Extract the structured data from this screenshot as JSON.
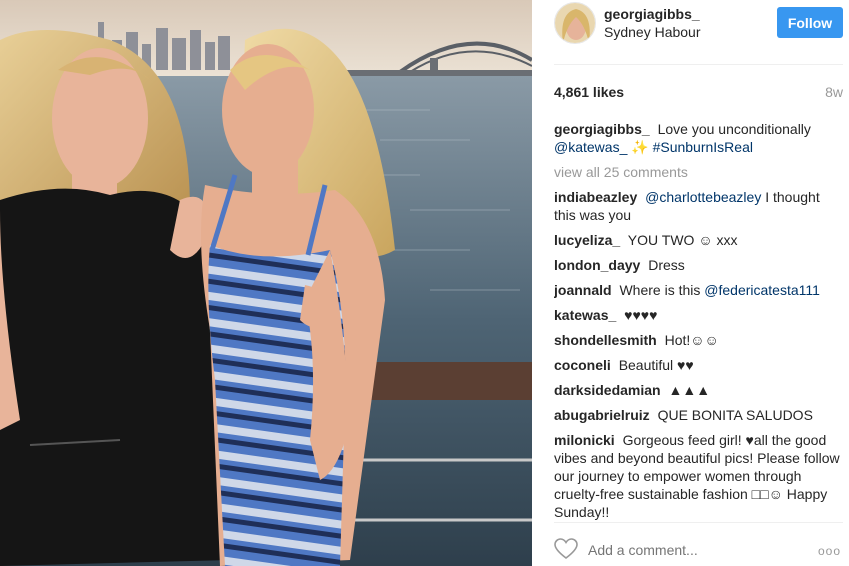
{
  "post": {
    "username": "georgiagibbs_",
    "location": "Sydney Habour",
    "follow_label": "Follow",
    "likes": "4,861 likes",
    "age": "8w",
    "add_comment_placeholder": "Add a comment...",
    "more_label": "ooo",
    "accent_color": "#3897f0"
  },
  "caption": {
    "user": "georgiagibbs_",
    "text_1": "Love you unconditionally",
    "mention": "@katewas_",
    "sparkle": "✨",
    "hashtag": "#SunburnIsReal"
  },
  "view_all": "view all 25 comments",
  "comments": [
    {
      "user": "indiabeazley",
      "link": "@charlottebeazley",
      "text": "I thought this was you"
    },
    {
      "user": "lucyeliza_",
      "text": "YOU TWO ☺ xxx"
    },
    {
      "user": "london_dayy",
      "text": "Dress"
    },
    {
      "user": "joannald",
      "text": "Where is this",
      "link": "@federicatesta111"
    },
    {
      "user": "katewas_",
      "text": "♥♥♥♥"
    },
    {
      "user": "shondellesmith",
      "text": "Hot!☺☺"
    },
    {
      "user": "coconeli",
      "text": "Beautiful ♥♥"
    },
    {
      "user": "darksidedamian",
      "text": "▲▲▲"
    },
    {
      "user": "abugabrielruiz",
      "text": "QUE BONITA SALUDOS"
    },
    {
      "user": "milonicki",
      "text": "Gorgeous feed girl! ♥all the good vibes and beyond beautiful pics! Please follow our journey to empower women through cruelty-free sustainable fashion □□☺ Happy Sunday!!"
    }
  ]
}
